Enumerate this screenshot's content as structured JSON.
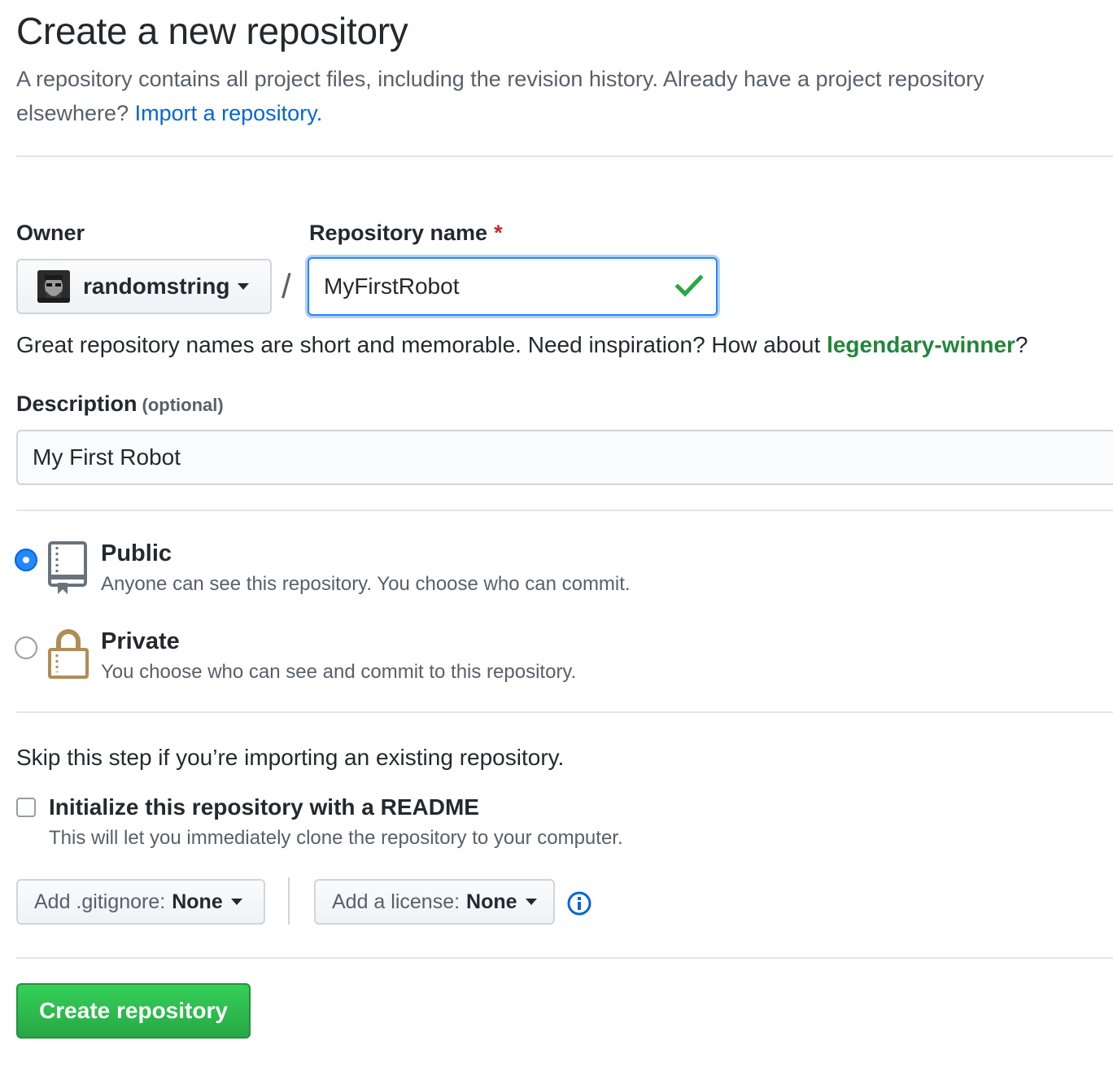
{
  "header": {
    "title": "Create a new repository",
    "subtitle": "A repository contains all project files, including the revision history. Already have a project repository elsewhere?",
    "import_link": "Import a repository."
  },
  "owner": {
    "label": "Owner",
    "value": "randomstring"
  },
  "repo_name": {
    "label": "Repository name",
    "required_mark": "*",
    "value": "MyFirstRobot",
    "separator": "/"
  },
  "hint": {
    "prefix": "Great repository names are short and memorable. Need inspiration? How about",
    "suggestion": "legendary-winner",
    "suffix": "?"
  },
  "description": {
    "label": "Description",
    "optional": "(optional)",
    "value": "My First Robot"
  },
  "visibility": {
    "public": {
      "title": "Public",
      "desc": "Anyone can see this repository. You choose who can commit.",
      "selected": true
    },
    "private": {
      "title": "Private",
      "desc": "You choose who can see and commit to this repository.",
      "selected": false
    }
  },
  "init": {
    "skip_text": "Skip this step if you’re importing an existing repository.",
    "readme_title": "Initialize this repository with a README",
    "readme_desc": "This will let you immediately clone the repository to your computer.",
    "readme_checked": false
  },
  "gitignore": {
    "label": "Add .gitignore:",
    "value": "None"
  },
  "license": {
    "label": "Add a license:",
    "value": "None"
  },
  "submit": {
    "label": "Create repository"
  },
  "colors": {
    "link": "#0366d6",
    "suggestion": "#22863a",
    "primary_button": "#28a745",
    "focus_border": "#2188ff",
    "required": "#cb2431"
  },
  "icons": [
    "caret-down-icon",
    "check-icon",
    "repo-book-icon",
    "lock-icon",
    "info-icon"
  ]
}
